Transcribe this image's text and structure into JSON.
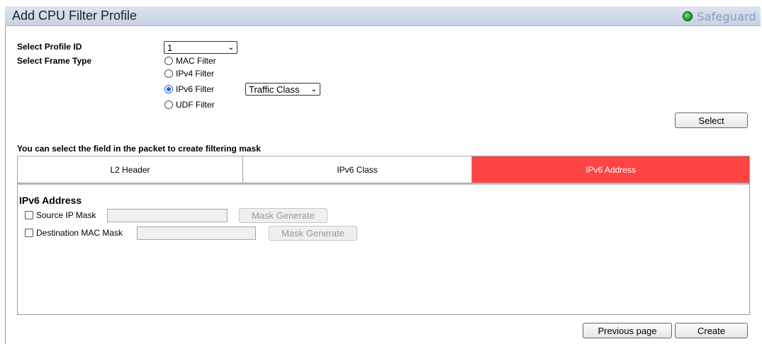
{
  "header": {
    "title": "Add CPU Filter Profile",
    "brand": "Safeguard",
    "brand_status_color": "#1f9a1f"
  },
  "form": {
    "profile_id_label": "Select Profile ID",
    "profile_id_value": "1",
    "frame_type_label": "Select Frame Type",
    "frame_types": [
      {
        "label": "MAC Filter",
        "selected": false
      },
      {
        "label": "IPv4 Filter",
        "selected": false
      },
      {
        "label": "IPv6 Filter",
        "selected": true
      },
      {
        "label": "UDF Filter",
        "selected": false
      }
    ],
    "ipv6_option_value": "Traffic Class",
    "select_button": "Select"
  },
  "mask_section": {
    "info_text": "You can select the field in the packet to create filtering mask",
    "tabs": [
      {
        "label": "L2 Header",
        "active": false
      },
      {
        "label": "IPv6 Class",
        "active": false
      },
      {
        "label": "IPv6 Address",
        "active": true
      }
    ],
    "active_tab_color": "#ff4444",
    "panel_title": "IPv6 Address",
    "rows": [
      {
        "label": "Source IP Mask",
        "value": "",
        "button": "Mask Generate",
        "checked": false
      },
      {
        "label": "Destination MAC Mask",
        "value": "",
        "button": "Mask Generate",
        "checked": false
      }
    ]
  },
  "footer": {
    "previous_button": "Previous page",
    "create_button": "Create"
  }
}
